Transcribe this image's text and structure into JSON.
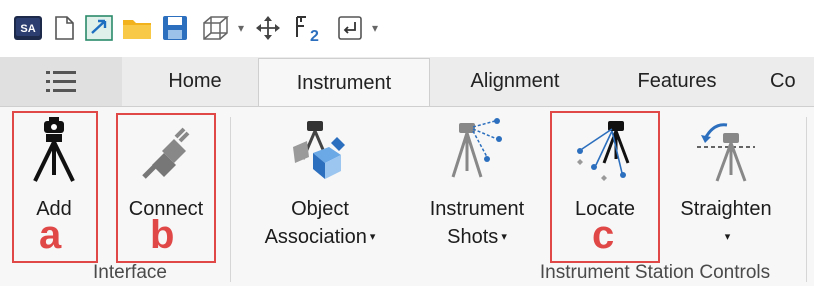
{
  "toolbar": {
    "icons": [
      "sa-logo-icon",
      "new-document-icon",
      "transform-icon",
      "open-folder-icon",
      "save-icon",
      "wireframe-box-icon",
      "move-icon",
      "f2-icon",
      "enter-icon",
      "customize-icon"
    ]
  },
  "tabs": [
    {
      "label": "Home"
    },
    {
      "label": "Instrument",
      "active": true
    },
    {
      "label": "Alignment"
    },
    {
      "label": "Features"
    },
    {
      "label": "Co"
    }
  ],
  "ribbon": {
    "buttons": [
      {
        "line1": "Add",
        "line2": "",
        "dropdown": false
      },
      {
        "line1": "Connect",
        "line2": "",
        "dropdown": false
      },
      {
        "line1": "Object",
        "line2": "Association",
        "dropdown": true
      },
      {
        "line1": "Instrument",
        "line2": "Shots",
        "dropdown": true
      },
      {
        "line1": "Locate",
        "line2": "",
        "dropdown": false
      },
      {
        "line1": "Straighten",
        "line2": "",
        "dropdown": true
      }
    ],
    "groups": [
      {
        "label": "Interface"
      },
      {
        "label": "Instrument Station Controls"
      }
    ]
  },
  "annotations": {
    "a": "a",
    "b": "b",
    "c": "c"
  },
  "colors": {
    "highlight": "#e04848",
    "accent_blue": "#2c6fbe"
  }
}
